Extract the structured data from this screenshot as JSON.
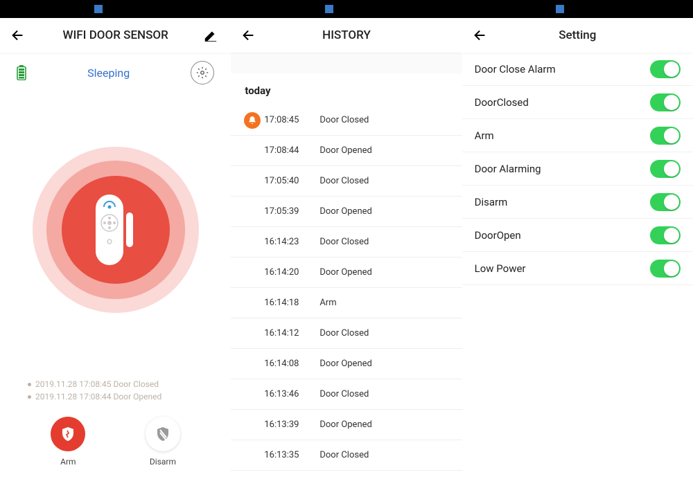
{
  "screen1": {
    "title": "WIFI DOOR SENSOR",
    "status": "Sleeping",
    "log1": "2019.11.28 17:08:45 Door Closed",
    "log2": "2019.11.28 17:08:44 Door Opened",
    "arm_label": "Arm",
    "disarm_label": "Disarm"
  },
  "screen2": {
    "title": "HISTORY",
    "section": "today",
    "rows": [
      {
        "time": "17:08:45",
        "event": "Door Closed",
        "bell": true
      },
      {
        "time": "17:08:44",
        "event": "Door Opened"
      },
      {
        "time": "17:05:40",
        "event": "Door Closed"
      },
      {
        "time": "17:05:39",
        "event": "Door Opened"
      },
      {
        "time": "16:14:23",
        "event": "Door Closed"
      },
      {
        "time": "16:14:20",
        "event": "Door Opened"
      },
      {
        "time": "16:14:18",
        "event": "Arm"
      },
      {
        "time": "16:14:12",
        "event": "Door Closed"
      },
      {
        "time": "16:14:08",
        "event": "Door Opened"
      },
      {
        "time": "16:13:46",
        "event": "Door Closed"
      },
      {
        "time": "16:13:39",
        "event": "Door Opened"
      },
      {
        "time": "16:13:35",
        "event": "Door Closed"
      }
    ]
  },
  "screen3": {
    "title": "Setting",
    "rows": [
      {
        "label": "Door Close Alarm",
        "on": true
      },
      {
        "label": "DoorClosed",
        "on": true
      },
      {
        "label": "Arm",
        "on": true
      },
      {
        "label": "Door Alarming",
        "on": true
      },
      {
        "label": "Disarm",
        "on": true
      },
      {
        "label": "DoorOpen",
        "on": true
      },
      {
        "label": "Low Power",
        "on": true
      }
    ]
  }
}
